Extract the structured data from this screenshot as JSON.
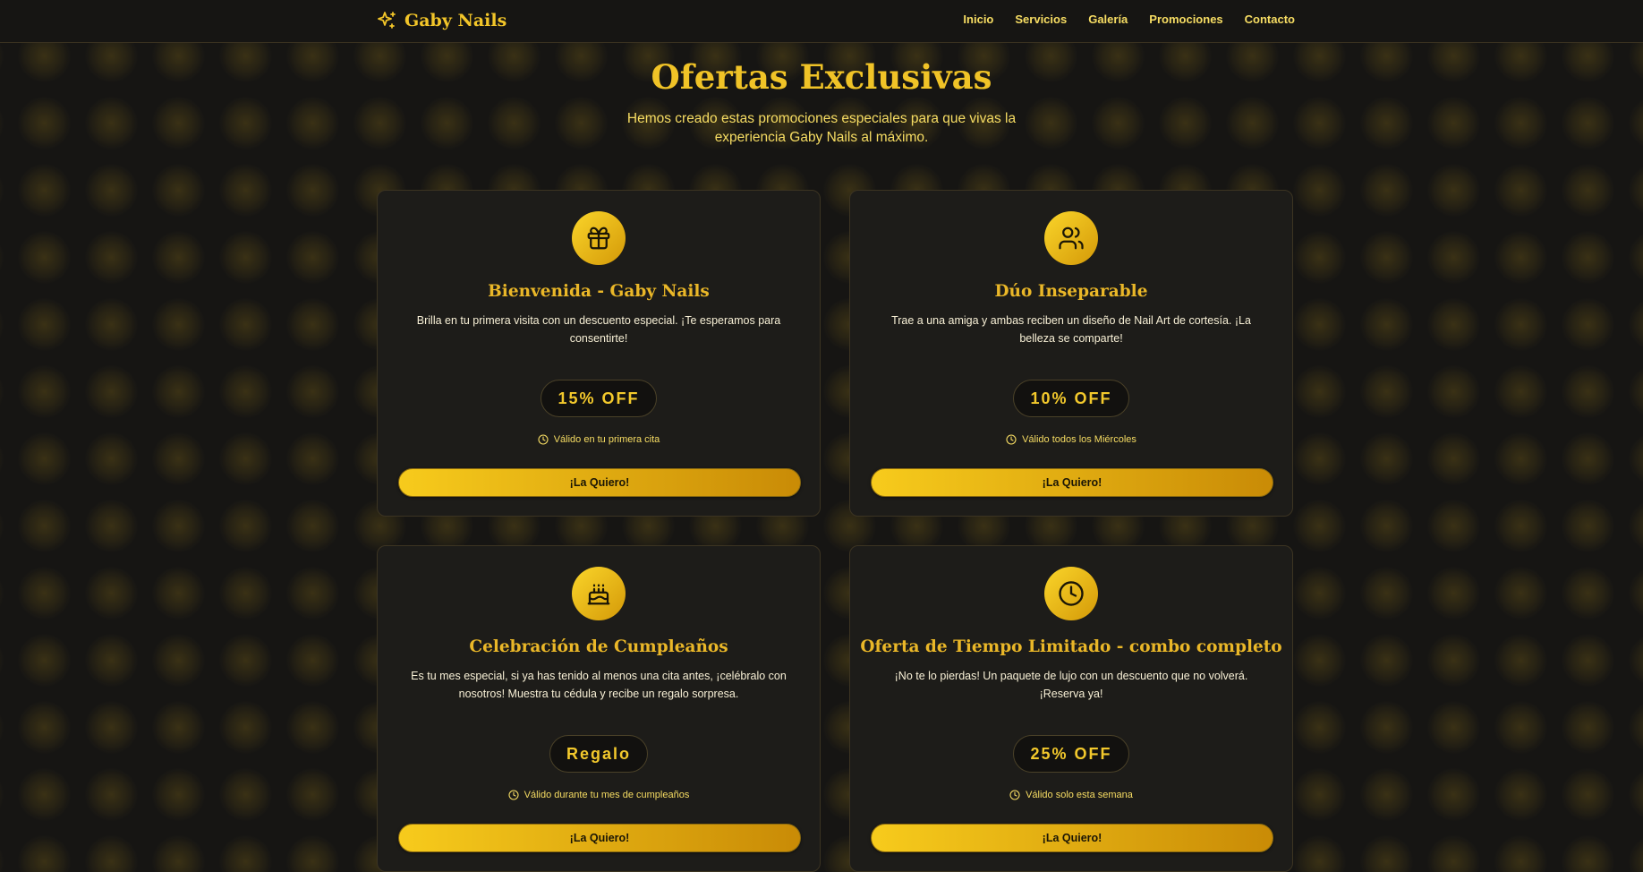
{
  "nav": {
    "brand": "Gaby Nails",
    "links": [
      "Inicio",
      "Servicios",
      "Galería",
      "Promociones",
      "Contacto"
    ]
  },
  "hero": {
    "title": "Ofertas Exclusivas",
    "subtitle": "Hemos creado estas promociones especiales para que vivas la experiencia Gaby Nails al máximo."
  },
  "offers": [
    {
      "icon": "gift-icon",
      "title": "Bienvenida - Gaby Nails",
      "description": "Brilla en tu primera visita con un descuento especial. ¡Te esperamos para consentirte!",
      "badge": "15% OFF",
      "validity": "Válido en tu primera cita",
      "cta": "¡La Quiero!"
    },
    {
      "icon": "users-icon",
      "title": "Dúo Inseparable",
      "description": "Trae a una amiga y ambas reciben un diseño de Nail Art de cortesía. ¡La belleza se comparte!",
      "badge": "10% OFF",
      "validity": "Válido todos los Miércoles",
      "cta": "¡La Quiero!"
    },
    {
      "icon": "birthday-cake-icon",
      "title": "Celebración de Cumpleaños",
      "description": "Es tu mes especial, si ya has tenido al menos una cita antes, ¡celébralo con nosotros! Muestra tu cédula y recibe un regalo sorpresa.",
      "badge": "Regalo",
      "validity": "Válido durante tu mes de cumpleaños",
      "cta": "¡La Quiero!"
    },
    {
      "icon": "clock-icon",
      "title": "Oferta de Tiempo Limitado - combo completo",
      "description": "¡No te lo pierdas! Un paquete de lujo con un descuento que no volverá. ¡Reserva ya!",
      "badge": "25% OFF",
      "validity": "Válido solo esta semana",
      "cta": "¡La Quiero!"
    }
  ],
  "colors": {
    "background": "#161513",
    "accent": "#f0c327",
    "card": "#1d1c19"
  }
}
